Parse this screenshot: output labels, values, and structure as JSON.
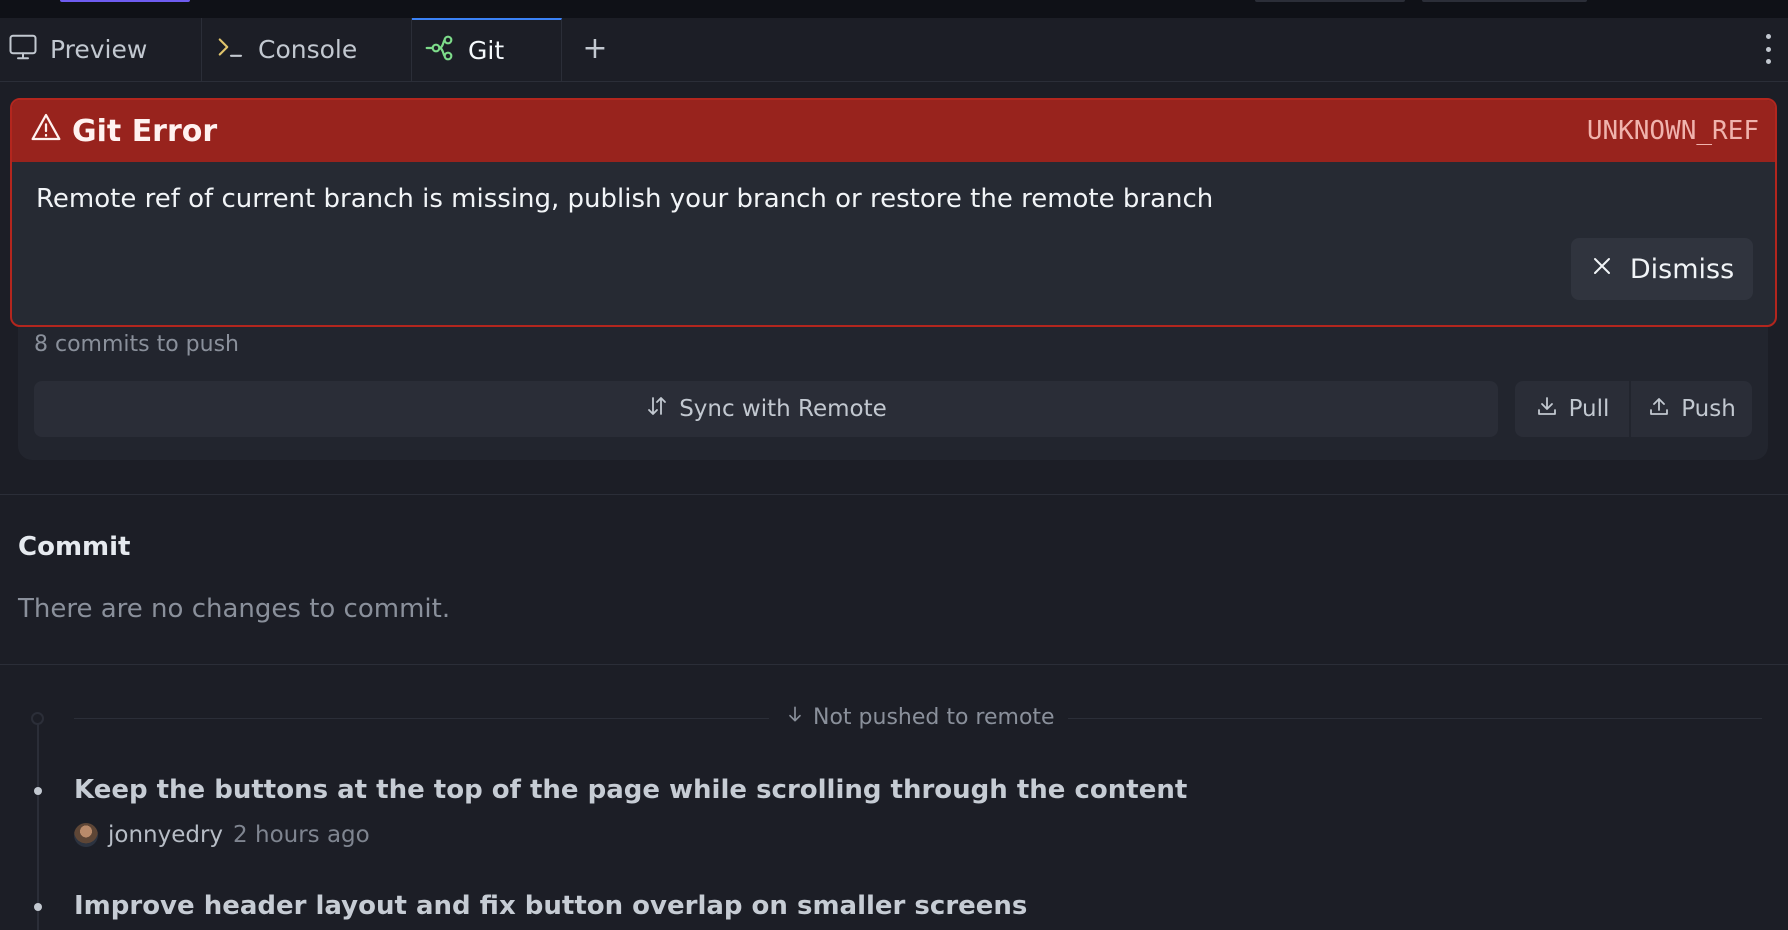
{
  "tabs": [
    {
      "label": "Preview",
      "icon": "monitor-icon",
      "active": false
    },
    {
      "label": "Console",
      "icon": "terminal-icon",
      "active": false
    },
    {
      "label": "Git",
      "icon": "git-branch-icon",
      "active": true
    }
  ],
  "alert": {
    "title": "Git Error",
    "code": "UNKNOWN_REF",
    "message": "Remote ref of current branch is missing, publish your branch or restore the remote branch",
    "dismiss_label": "Dismiss",
    "header_color": "#98231d",
    "border_color": "#b3261e"
  },
  "remote": {
    "commits_to_push": "8 commits to push",
    "sync_label": "Sync with Remote",
    "pull_label": "Pull",
    "push_label": "Push"
  },
  "commit_section": {
    "title": "Commit",
    "empty_text": "There are no changes to commit."
  },
  "history": {
    "not_pushed_label": "Not pushed to remote",
    "commits": [
      {
        "message": "Keep the buttons at the top of the page while scrolling through the content",
        "author": "jonnyedry",
        "time": "2 hours ago"
      },
      {
        "message": "Improve header layout and fix button overlap on smaller screens"
      }
    ]
  },
  "colors": {
    "accent_tab": "#3b82f6",
    "git_icon": "#7ddb8a",
    "console_icon": "#e0c46c"
  }
}
